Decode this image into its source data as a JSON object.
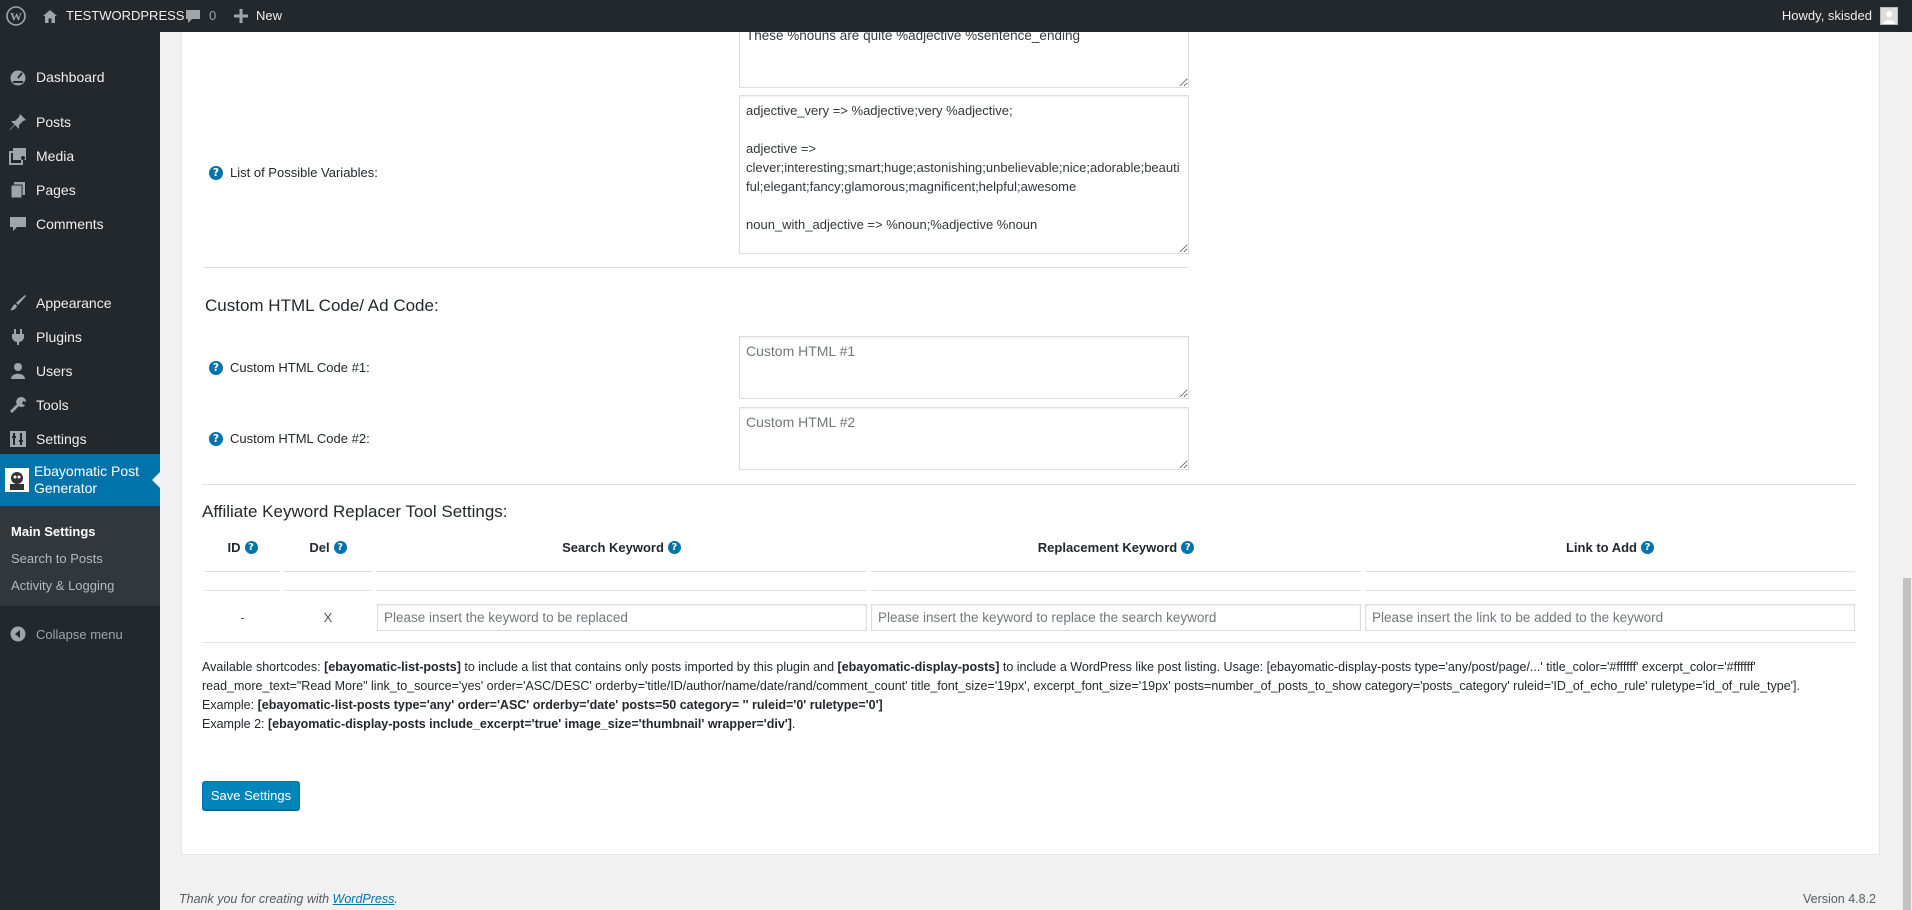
{
  "admin_bar": {
    "site_name": "TESTWORDPRESS",
    "comments_count": "0",
    "new_label": "New",
    "greeting": "Howdy, skisded"
  },
  "sidebar": {
    "items": [
      {
        "label": "Dashboard",
        "icon": "dashboard-icon"
      },
      {
        "label": "Posts",
        "icon": "pin-icon"
      },
      {
        "label": "Media",
        "icon": "media-icon"
      },
      {
        "label": "Pages",
        "icon": "pages-icon"
      },
      {
        "label": "Comments",
        "icon": "comment-icon"
      },
      {
        "label": "Appearance",
        "icon": "brush-icon"
      },
      {
        "label": "Plugins",
        "icon": "plugin-icon"
      },
      {
        "label": "Users",
        "icon": "user-icon"
      },
      {
        "label": "Tools",
        "icon": "wrench-icon"
      },
      {
        "label": "Settings",
        "icon": "settings-icon"
      }
    ],
    "active_plugin": "Ebayomatic Post Generator",
    "submenu": [
      "Main Settings",
      "Search to Posts",
      "Activity & Logging"
    ],
    "collapse_label": "Collapse menu"
  },
  "form": {
    "sentence_textarea_value": "These %nouns are quite %adjective %sentence_ending",
    "variables_label": "List of Possible Variables:",
    "variables_textarea_value": "adjective_very => %adjective;very %adjective;\n\nadjective => clever;interesting;smart;huge;astonishing;unbelievable;nice;adorable;beautiful;elegant;fancy;glamorous;magnificent;helpful;awesome\n\nnoun_with_adjective => %noun;%adjective %noun\n\nnoun => plugin;WordPress plugin;item;ingredient;component;constituent;module;add-on;plug-in;addon;extension",
    "custom_html_section_title": "Custom HTML Code/ Ad Code:",
    "custom_html_1_label": "Custom HTML Code #1:",
    "custom_html_1_placeholder": "Custom HTML #1",
    "custom_html_2_label": "Custom HTML Code #2:",
    "custom_html_2_placeholder": "Custom HTML #2",
    "affiliate_section_title": "Affiliate Keyword Replacer Tool Settings:",
    "table_headers": {
      "id": "ID",
      "del": "Del",
      "search_keyword": "Search Keyword",
      "replacement_keyword": "Replacement Keyword",
      "link_to_add": "Link to Add"
    },
    "new_row": {
      "id": "-",
      "del": "X",
      "search_placeholder": "Please insert the keyword to be replaced",
      "replacement_placeholder": "Please insert the keyword to replace the search keyword",
      "link_placeholder": "Please insert the link to be added to the keyword"
    },
    "info": {
      "line1_a": "Available shortcodes: ",
      "line1_b": "[ebayomatic-list-posts]",
      "line1_c": " to include a list that contains only posts imported by this plugin and ",
      "line1_d": "[ebayomatic-display-posts]",
      "line1_e": " to include a WordPress like post listing. Usage: [ebayomatic-display-posts type='any/post/page/...' title_color='#ffffff' excerpt_color='#ffffff' read_more_text=\"Read More\" link_to_source='yes' order='ASC/DESC' orderby='title/ID/author/name/date/rand/comment_count' title_font_size='19px', excerpt_font_size='19px' posts=number_of_posts_to_show category='posts_category' ruleid='ID_of_echo_rule' ruletype='id_of_rule_type'].",
      "line2_a": "Example: ",
      "line2_b": "[ebayomatic-list-posts type='any' order='ASC' orderby='date' posts=50 category= '' ruleid='0' ruletype='0']",
      "line3_a": "Example 2: ",
      "line3_b": "[ebayomatic-display-posts include_excerpt='true' image_size='thumbnail' wrapper='div']",
      "line3_c": "."
    },
    "save_button": "Save Settings"
  },
  "footer": {
    "thanks_prefix": "Thank you for creating with ",
    "thanks_link": "WordPress",
    "thanks_suffix": ".",
    "version": "Version 4.8.2"
  },
  "colors": {
    "admin_bg": "#23282d",
    "accent": "#0073aa",
    "button": "#0085ba"
  }
}
